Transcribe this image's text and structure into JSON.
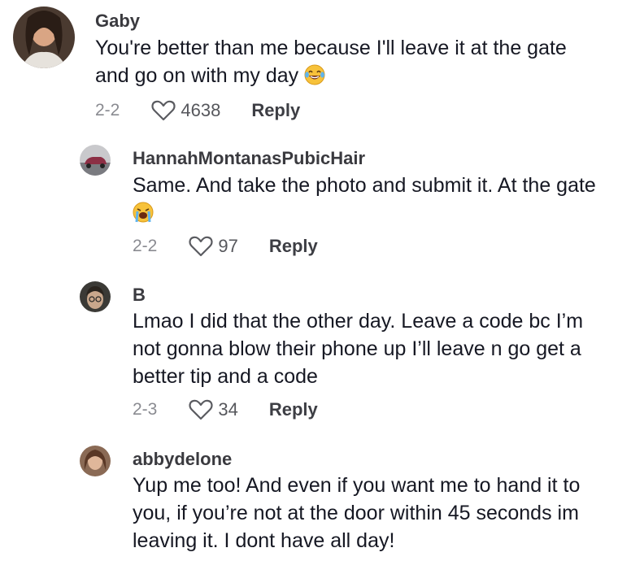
{
  "comments": [
    {
      "username": "Gaby",
      "lines": [
        "You're better than me because I'll leave it at the gate",
        "and go on with my day"
      ],
      "emoji": "face-with-tears-of-joy",
      "date": "2-2",
      "likes": "4638",
      "reply_label": "Reply"
    },
    {
      "username": "HannahMontanasPubicHair",
      "lines": [
        "Same. And take the photo and submit it. At the gate",
        ""
      ],
      "emoji": "loudly-crying-face",
      "date": "2-2",
      "likes": "97",
      "reply_label": "Reply"
    },
    {
      "username": "B",
      "lines": [
        "Lmao I did that the other day. Leave a code bc I’m",
        "not gonna blow their phone up I’ll leave n go get a",
        "better tip and a code"
      ],
      "date": "2-3",
      "likes": "34",
      "reply_label": "Reply"
    },
    {
      "username": "abbydelone",
      "lines": [
        "Yup me too! And even if you want me to hand it to",
        "you, if you’re not at the door within 45 seconds im",
        "leaving it. I dont have all day!"
      ]
    }
  ],
  "icons": {
    "like": "heart-outline-icon"
  },
  "colors": {
    "text": "#161823",
    "muted": "#8a8b91",
    "username": "#3a3a3f"
  }
}
